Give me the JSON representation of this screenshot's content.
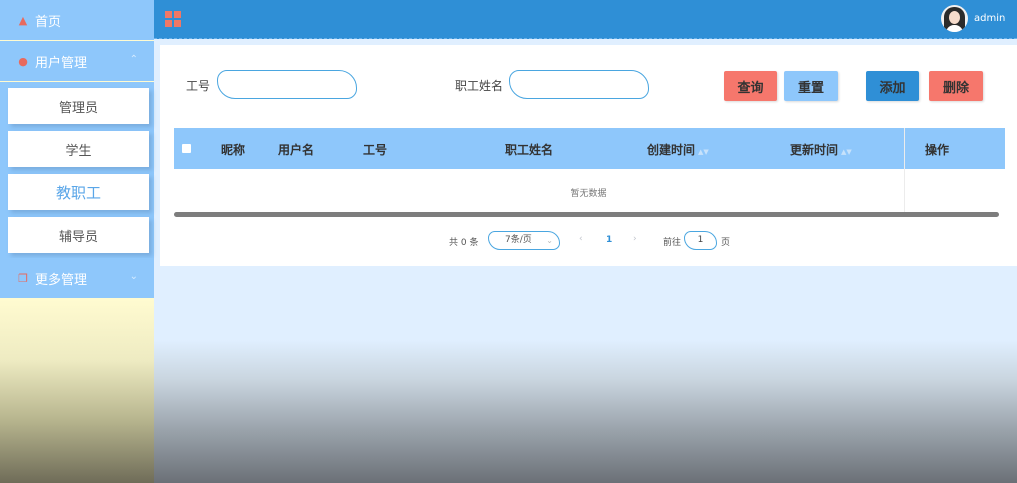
{
  "sidebar": {
    "home": {
      "label": "首页",
      "icon": "home-icon"
    },
    "user_mgmt": {
      "label": "用户管理",
      "icon": "user-icon",
      "expanded": true
    },
    "items": [
      {
        "label": "管理员"
      },
      {
        "label": "学生"
      },
      {
        "label": "教职工",
        "active": true
      },
      {
        "label": "辅导员"
      }
    ],
    "more_mgmt": {
      "label": "更多管理",
      "icon": "copy-icon"
    }
  },
  "header": {
    "username": "admin",
    "menu_icon": "grid-icon"
  },
  "search": {
    "employee_no_label": "工号",
    "employee_no_value": "",
    "staff_name_label": "职工姓名",
    "staff_name_value": ""
  },
  "toolbar": {
    "query": "查询",
    "reset": "重置",
    "add": "添加",
    "delete": "删除"
  },
  "table": {
    "columns": [
      "昵称",
      "用户名",
      "工号",
      "职工姓名",
      "创建时间",
      "更新时间",
      "操作"
    ],
    "empty_text": "暂无数据"
  },
  "pagination": {
    "total_text": "共 0 条",
    "page_size": "7条/页",
    "prev": "‹",
    "current_page": "1",
    "next": "›",
    "goto_label": "前往",
    "goto_value": "1",
    "page_suffix": "页"
  },
  "colors": {
    "sidebar_blue": "#8ec7fb",
    "header_blue": "#2f8fd6",
    "danger": "#f6776c",
    "active_text": "#5aa6e8"
  }
}
